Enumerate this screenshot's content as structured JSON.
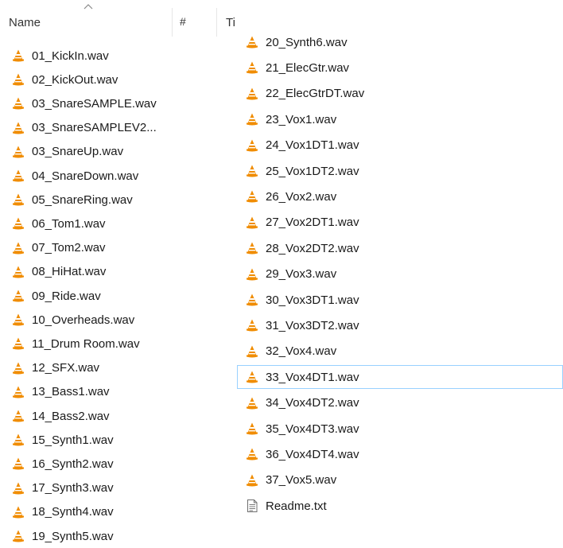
{
  "header": {
    "name_label": "Name",
    "number_label": "#",
    "title_label": "Ti",
    "sort_icon": "chevron-up-icon"
  },
  "colors": {
    "vlc_orange": "#f08c00",
    "vlc_stripe": "#ffffff",
    "selection_border": "#99d1ff"
  },
  "left_files": [
    {
      "name": "01_KickIn.wav",
      "icon": "vlc-cone-icon"
    },
    {
      "name": "02_KickOut.wav",
      "icon": "vlc-cone-icon"
    },
    {
      "name": "03_SnareSAMPLE.wav",
      "icon": "vlc-cone-icon"
    },
    {
      "name": "03_SnareSAMPLEV2...",
      "icon": "vlc-cone-icon"
    },
    {
      "name": "03_SnareUp.wav",
      "icon": "vlc-cone-icon"
    },
    {
      "name": "04_SnareDown.wav",
      "icon": "vlc-cone-icon"
    },
    {
      "name": "05_SnareRing.wav",
      "icon": "vlc-cone-icon"
    },
    {
      "name": "06_Tom1.wav",
      "icon": "vlc-cone-icon"
    },
    {
      "name": "07_Tom2.wav",
      "icon": "vlc-cone-icon"
    },
    {
      "name": "08_HiHat.wav",
      "icon": "vlc-cone-icon"
    },
    {
      "name": "09_Ride.wav",
      "icon": "vlc-cone-icon"
    },
    {
      "name": "10_Overheads.wav",
      "icon": "vlc-cone-icon"
    },
    {
      "name": "11_Drum Room.wav",
      "icon": "vlc-cone-icon"
    },
    {
      "name": "12_SFX.wav",
      "icon": "vlc-cone-icon"
    },
    {
      "name": "13_Bass1.wav",
      "icon": "vlc-cone-icon"
    },
    {
      "name": "14_Bass2.wav",
      "icon": "vlc-cone-icon"
    },
    {
      "name": "15_Synth1.wav",
      "icon": "vlc-cone-icon"
    },
    {
      "name": "16_Synth2.wav",
      "icon": "vlc-cone-icon"
    },
    {
      "name": "17_Synth3.wav",
      "icon": "vlc-cone-icon"
    },
    {
      "name": "18_Synth4.wav",
      "icon": "vlc-cone-icon"
    },
    {
      "name": "19_Synth5.wav",
      "icon": "vlc-cone-icon"
    }
  ],
  "right_files": [
    {
      "name": "20_Synth6.wav",
      "icon": "vlc-cone-icon"
    },
    {
      "name": "21_ElecGtr.wav",
      "icon": "vlc-cone-icon"
    },
    {
      "name": "22_ElecGtrDT.wav",
      "icon": "vlc-cone-icon"
    },
    {
      "name": "23_Vox1.wav",
      "icon": "vlc-cone-icon"
    },
    {
      "name": "24_Vox1DT1.wav",
      "icon": "vlc-cone-icon"
    },
    {
      "name": "25_Vox1DT2.wav",
      "icon": "vlc-cone-icon"
    },
    {
      "name": "26_Vox2.wav",
      "icon": "vlc-cone-icon"
    },
    {
      "name": "27_Vox2DT1.wav",
      "icon": "vlc-cone-icon"
    },
    {
      "name": "28_Vox2DT2.wav",
      "icon": "vlc-cone-icon"
    },
    {
      "name": "29_Vox3.wav",
      "icon": "vlc-cone-icon"
    },
    {
      "name": "30_Vox3DT1.wav",
      "icon": "vlc-cone-icon"
    },
    {
      "name": "31_Vox3DT2.wav",
      "icon": "vlc-cone-icon"
    },
    {
      "name": "32_Vox4.wav",
      "icon": "vlc-cone-icon"
    },
    {
      "name": "33_Vox4DT1.wav",
      "icon": "vlc-cone-icon",
      "selected": true
    },
    {
      "name": "34_Vox4DT2.wav",
      "icon": "vlc-cone-icon"
    },
    {
      "name": "35_Vox4DT3.wav",
      "icon": "vlc-cone-icon"
    },
    {
      "name": "36_Vox4DT4.wav",
      "icon": "vlc-cone-icon"
    },
    {
      "name": "37_Vox5.wav",
      "icon": "vlc-cone-icon"
    },
    {
      "name": "Readme.txt",
      "icon": "text-file-icon"
    }
  ]
}
